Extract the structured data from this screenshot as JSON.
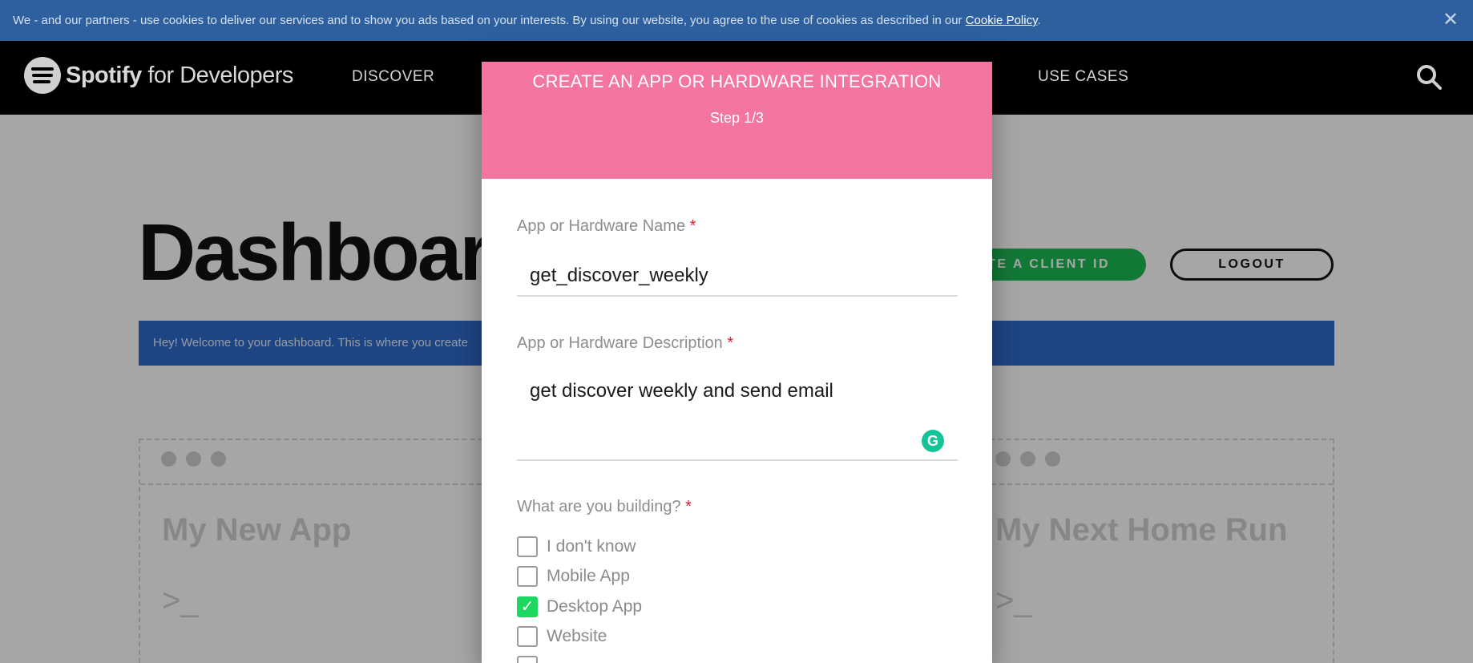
{
  "cookie_banner": {
    "text": "We - and our partners - use cookies to deliver our services and to show you ads based on your interests. By using our website, you agree to the use of cookies as described in our ",
    "link": "Cookie Policy",
    "suffix": ".",
    "close_glyph": "✕"
  },
  "nav": {
    "logo_brand": "Spotify",
    "logo_suffix": "for Developers",
    "items": [
      "DISCOVER",
      "USE CASES"
    ],
    "search_icon": "search-icon"
  },
  "dashboard": {
    "title": "Dashboar",
    "create_button": "TE A CLIENT ID",
    "logout_button": "LOGOUT",
    "welcome": "Hey! Welcome to your dashboard. This is where you create",
    "cards": [
      {
        "title": "My New App",
        "prompt": ">_"
      },
      {
        "title": "My Next Home Run",
        "prompt": ">_"
      }
    ]
  },
  "modal": {
    "title": "CREATE AN APP OR HARDWARE INTEGRATION",
    "step": "Step 1/3",
    "name_label": "App or Hardware Name",
    "name_value": "get_discover_weekly",
    "desc_label": "App or Hardware Description",
    "desc_value": "get discover weekly and send email",
    "required_mark": "*",
    "building_label": "What are you building?",
    "options": [
      {
        "label": "I don't know",
        "checked": false
      },
      {
        "label": "Mobile App",
        "checked": false
      },
      {
        "label": "Desktop App",
        "checked": true
      },
      {
        "label": "Website",
        "checked": false
      }
    ],
    "checkmark": "✓",
    "grammarly": "G"
  },
  "colors": {
    "modal_header": "#f474a2",
    "cookie_bar": "#2e5f9e",
    "spotify_green": "#1db954",
    "welcome_bar": "#2f6bc9"
  }
}
